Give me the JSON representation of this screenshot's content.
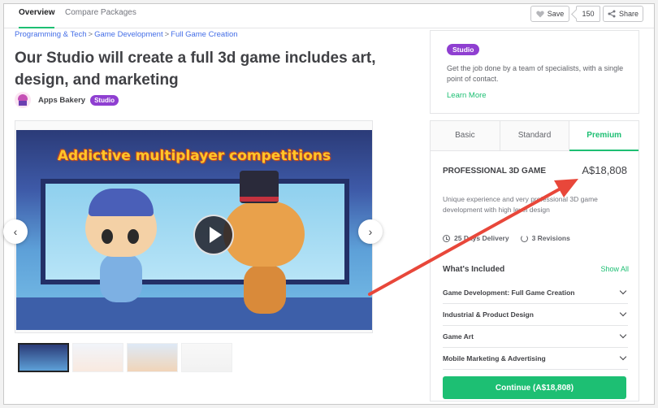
{
  "nav": {
    "tabs": [
      {
        "label": "Overview",
        "active": true
      },
      {
        "label": "Compare Packages",
        "active": false
      }
    ],
    "save_label": "Save",
    "save_count": "150",
    "share_label": "Share"
  },
  "breadcrumb": {
    "items": [
      "Programming & Tech",
      "Game Development",
      "Full Game Creation"
    ],
    "separator": ">"
  },
  "gig": {
    "title": "Our Studio will create a full 3d game includes art, design, and marketing",
    "seller_name": "Apps Bakery",
    "seller_badge": "Studio"
  },
  "media": {
    "banner_text": "Addictive multiplayer competitions",
    "thumbnail_count": 4,
    "active_thumbnail": 0
  },
  "studio_card": {
    "badge": "Studio",
    "description": "Get the job done by a team of specialists, with a single point of contact.",
    "link": "Learn More"
  },
  "package": {
    "tabs": [
      "Basic",
      "Standard",
      "Premium"
    ],
    "active_tab": "Premium",
    "name": "PROFESSIONAL 3D GAME",
    "price": "A$18,808",
    "description": "Unique experience and very professional 3D game development with high level design",
    "delivery": "25 Days Delivery",
    "revisions": "3 Revisions",
    "included_heading": "What's Included",
    "show_all": "Show All",
    "included": [
      "Game Development: Full Game Creation",
      "Industrial & Product Design",
      "Game Art",
      "Mobile Marketing & Advertising"
    ],
    "continue_label": "Continue (A$18,808)"
  },
  "colors": {
    "accent_green": "#1dbf73",
    "studio_purple": "#8f3fd1",
    "link_blue": "#446ee7",
    "annotation_red": "#e8473a"
  },
  "icons": [
    "heart-icon",
    "share-icon",
    "chevron-left-icon",
    "chevron-right-icon",
    "play-icon",
    "clock-icon",
    "refresh-icon",
    "chevron-down-icon"
  ]
}
